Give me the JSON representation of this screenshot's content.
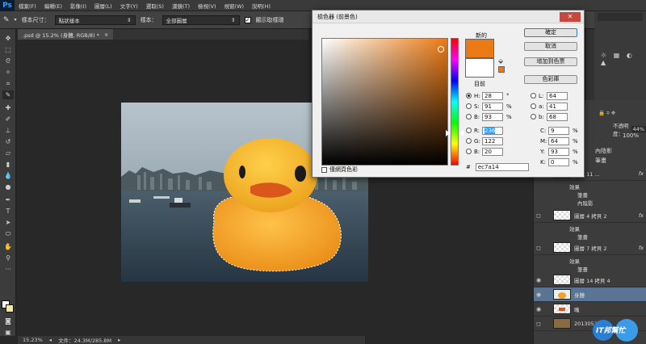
{
  "menu": {
    "logo": "Ps",
    "items": [
      "檔案(F)",
      "編輯(E)",
      "影像(I)",
      "圖層(L)",
      "文字(Y)",
      "選取(S)",
      "濾鏡(T)",
      "檢視(V)",
      "視窗(W)",
      "說明(H)"
    ]
  },
  "options": {
    "sample_size_label": "樣本尺寸：",
    "sample_size_value": "點狀樣本",
    "sample_label": "樣本：",
    "sample_value": "全部圖層",
    "show_ring_label": "顯示取樣環"
  },
  "document": {
    "tab_title": ".psd @ 15.2% (身體, RGB/8) *",
    "status_zoom": "15.23%",
    "status_file": "文件：24.3M/285.8M"
  },
  "picker": {
    "title": "檢色器 (前景色)",
    "close_glyph": "✕",
    "new_label": "新的",
    "current_label": "目前",
    "new_color": "#ec7a14",
    "current_color": "#ffffff",
    "buttons": {
      "ok": "確定",
      "cancel": "取消",
      "add_swatch": "增加到色票",
      "libraries": "色彩庫"
    },
    "web_only_label": "僅網頁色彩",
    "fields": {
      "H": {
        "label": "H:",
        "value": "28",
        "unit": "°"
      },
      "S": {
        "label": "S:",
        "value": "91",
        "unit": "%"
      },
      "B": {
        "label": "B:",
        "value": "93",
        "unit": "%"
      },
      "R": {
        "label": "R:",
        "value": "236",
        "unit": ""
      },
      "G": {
        "label": "G:",
        "value": "122",
        "unit": ""
      },
      "Bl": {
        "label": "B:",
        "value": "20",
        "unit": ""
      },
      "L": {
        "label": "L:",
        "value": "64",
        "unit": ""
      },
      "a": {
        "label": "a:",
        "value": "41",
        "unit": ""
      },
      "b": {
        "label": "b:",
        "value": "68",
        "unit": ""
      },
      "C": {
        "label": "C:",
        "value": "9",
        "unit": "%"
      },
      "M": {
        "label": "M:",
        "value": "64",
        "unit": "%"
      },
      "Y": {
        "label": "Y:",
        "value": "93",
        "unit": "%"
      },
      "K": {
        "label": "K:",
        "value": "0",
        "unit": "%"
      }
    },
    "hex_label": "#",
    "hex_value": "ec7a14"
  },
  "layers": {
    "opacity_label": "不透明度：",
    "opacity_value": "44%",
    "fill_value": "100%",
    "rows": [
      {
        "name": "圖層 11 ...",
        "fx": "fx"
      },
      {
        "sub": "效果"
      },
      {
        "sub": "筆畫"
      },
      {
        "sub": "內陰影"
      },
      {
        "name": "圖層 4 拷貝 2",
        "fx": "fx"
      },
      {
        "sub": "效果"
      },
      {
        "sub": "筆畫"
      },
      {
        "name": "圖層 7 拷貝 2",
        "fx": "fx"
      },
      {
        "sub": "效果"
      },
      {
        "sub": "筆畫"
      },
      {
        "name": "圖層 14 拷貝 4"
      },
      {
        "name": "身體"
      },
      {
        "name": "嘴"
      },
      {
        "name": "20130521..."
      }
    ],
    "top_labels": [
      "內陰影",
      "筆畫"
    ]
  },
  "watermark": "IT邦幫忙"
}
